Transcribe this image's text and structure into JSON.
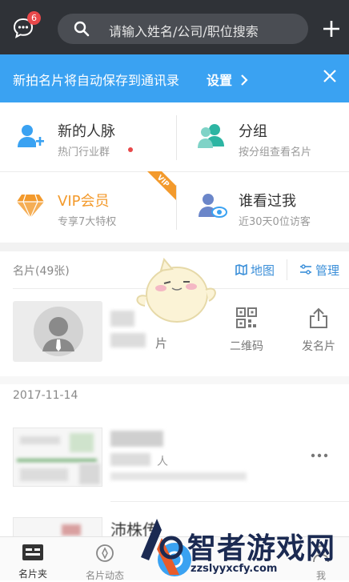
{
  "header": {
    "message_badge": "6",
    "search_placeholder": "请输入姓名/公司/职位搜索"
  },
  "banner": {
    "text": "新拍名片将自动保存到通讯录",
    "settings_label": "设置"
  },
  "quick_grid": [
    {
      "title": "新的人脉",
      "subtitle": "热门行业群"
    },
    {
      "title": "分组",
      "subtitle": "按分组查看名片"
    },
    {
      "title": "VIP会员",
      "subtitle": "专享7大特权",
      "tag": "VIP"
    },
    {
      "title": "谁看过我",
      "subtitle": "近30天0位访客"
    }
  ],
  "cards_section": {
    "title": "名片(49张)",
    "map_label": "地图",
    "manage_label": "管理"
  },
  "my_card": {
    "partial_label": "片",
    "qrcode_label": "二维码",
    "send_label": "发名片"
  },
  "list": {
    "date": "2017-11-14",
    "row1_partial": "人",
    "more_icon": "more-dots-icon",
    "row2_partial": "沛株传"
  },
  "tabs": [
    {
      "label": "名片夹",
      "active": true
    },
    {
      "label": "名片动态",
      "active": false
    },
    {
      "label": "我",
      "active": false
    }
  ],
  "watermark": {
    "text": "智者游戏网",
    "url": "zzslyyxcfy.com"
  },
  "colors": {
    "topbar": "#2f3237",
    "banner": "#3aa2f2",
    "accent_blue": "#3b8fd9",
    "vip_orange": "#f39a2c",
    "badge_red": "#e8484a"
  }
}
